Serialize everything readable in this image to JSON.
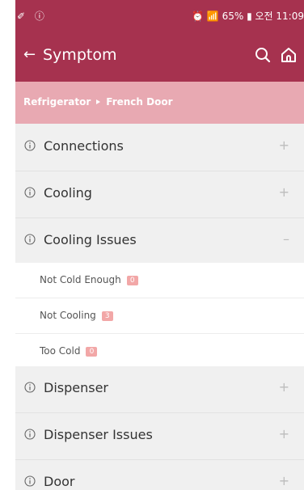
{
  "status_bar": {
    "left_icons": "✐ ⓘ",
    "right_text": "⏰ 📶 65% ▮ 오전 11:09"
  },
  "app_bar": {
    "title": "Symptom"
  },
  "breadcrumb": {
    "level1": "Refrigerator",
    "level2": "French Door"
  },
  "categories": [
    {
      "label": "Connections",
      "toggle": "+"
    },
    {
      "label": "Cooling",
      "toggle": "+"
    },
    {
      "label": "Cooling Issues",
      "toggle": "–"
    },
    {
      "label": "Dispenser",
      "toggle": "+"
    },
    {
      "label": "Dispenser Issues",
      "toggle": "+"
    },
    {
      "label": "Door",
      "toggle": "+"
    }
  ],
  "cooling_issues_items": [
    {
      "label": "Not Cold Enough",
      "count": "0"
    },
    {
      "label": "Not Cooling",
      "count": "3"
    },
    {
      "label": "Too Cold",
      "count": "0"
    }
  ],
  "colors": {
    "primary": "#a6324f",
    "breadcrumb_bg": "#e8a9b2",
    "badge": "#f2a7a7"
  }
}
